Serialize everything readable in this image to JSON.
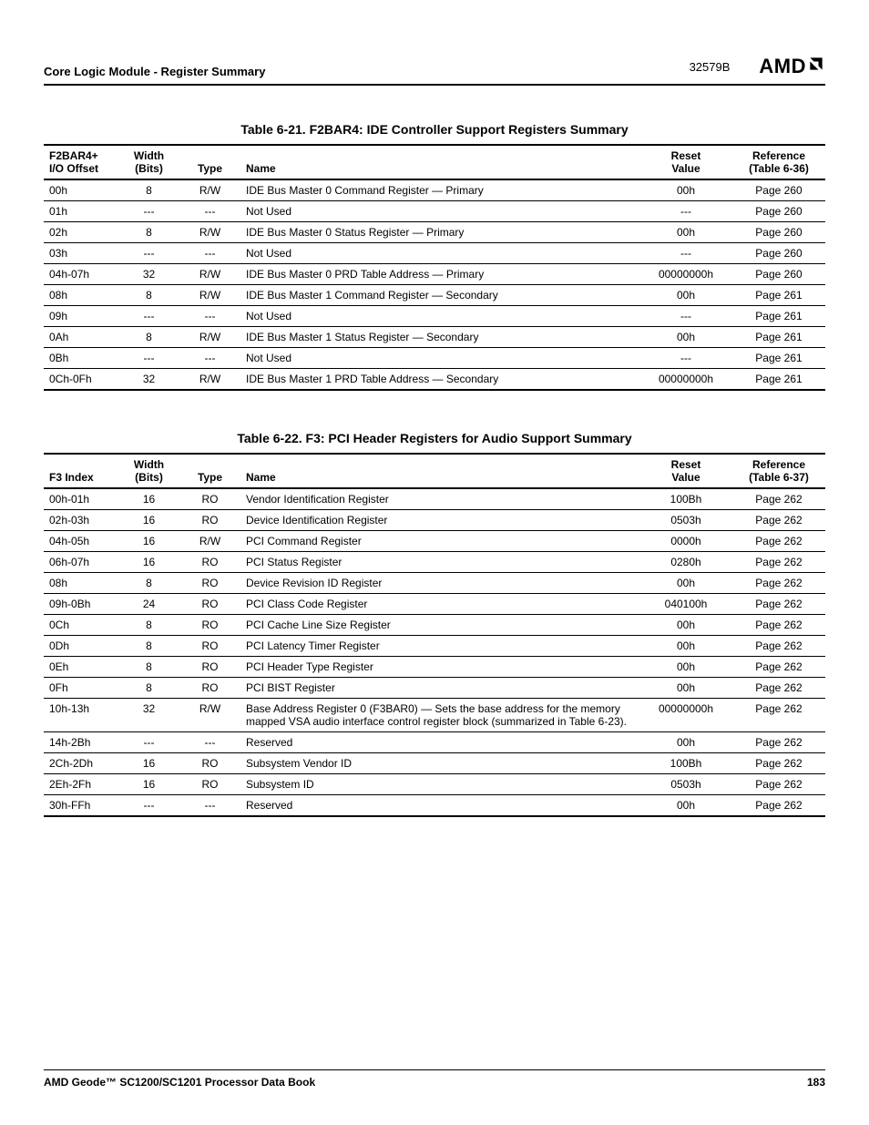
{
  "header": {
    "section": "Core Logic Module - Register Summary",
    "docnum": "32579B",
    "logo_text": "AMD"
  },
  "table1": {
    "caption": "Table 6-21.  F2BAR4: IDE Controller Support Registers Summary",
    "headers": {
      "offset": "F2BAR4+\nI/O Offset",
      "width": "Width\n(Bits)",
      "type": "Type",
      "name": "Name",
      "reset": "Reset\nValue",
      "ref": "Reference\n(Table 6-36)"
    },
    "rows": [
      {
        "offset": "00h",
        "width": "8",
        "type": "R/W",
        "name": "IDE Bus Master 0 Command Register — Primary",
        "reset": "00h",
        "ref": "Page 260"
      },
      {
        "offset": "01h",
        "width": "---",
        "type": "---",
        "name": "Not Used",
        "reset": "---",
        "ref": "Page 260"
      },
      {
        "offset": "02h",
        "width": "8",
        "type": "R/W",
        "name": "IDE Bus Master 0 Status Register — Primary",
        "reset": "00h",
        "ref": "Page 260"
      },
      {
        "offset": "03h",
        "width": "---",
        "type": "---",
        "name": "Not Used",
        "reset": "---",
        "ref": "Page 260"
      },
      {
        "offset": "04h-07h",
        "width": "32",
        "type": "R/W",
        "name": "IDE Bus Master 0 PRD Table Address — Primary",
        "reset": "00000000h",
        "ref": "Page 260"
      },
      {
        "offset": "08h",
        "width": "8",
        "type": "R/W",
        "name": "IDE Bus Master 1 Command Register — Secondary",
        "reset": "00h",
        "ref": "Page 261"
      },
      {
        "offset": "09h",
        "width": "---",
        "type": "---",
        "name": "Not Used",
        "reset": "---",
        "ref": "Page 261"
      },
      {
        "offset": "0Ah",
        "width": "8",
        "type": "R/W",
        "name": "IDE Bus Master 1 Status Register — Secondary",
        "reset": "00h",
        "ref": "Page 261"
      },
      {
        "offset": "0Bh",
        "width": "---",
        "type": "---",
        "name": "Not Used",
        "reset": "---",
        "ref": "Page 261"
      },
      {
        "offset": "0Ch-0Fh",
        "width": "32",
        "type": "R/W",
        "name": "IDE Bus Master 1 PRD Table Address — Secondary",
        "reset": "00000000h",
        "ref": "Page 261"
      }
    ]
  },
  "table2": {
    "caption": "Table 6-22.  F3: PCI Header Registers for Audio Support Summary",
    "headers": {
      "offset": "F3 Index",
      "width": "Width\n(Bits)",
      "type": "Type",
      "name": "Name",
      "reset": "Reset\nValue",
      "ref": "Reference\n(Table 6-37)"
    },
    "rows": [
      {
        "offset": "00h-01h",
        "width": "16",
        "type": "RO",
        "name": "Vendor Identification Register",
        "reset": "100Bh",
        "ref": "Page 262"
      },
      {
        "offset": "02h-03h",
        "width": "16",
        "type": "RO",
        "name": "Device Identification Register",
        "reset": "0503h",
        "ref": "Page 262"
      },
      {
        "offset": "04h-05h",
        "width": "16",
        "type": "R/W",
        "name": "PCI Command Register",
        "reset": "0000h",
        "ref": "Page 262"
      },
      {
        "offset": "06h-07h",
        "width": "16",
        "type": "RO",
        "name": "PCI Status Register",
        "reset": "0280h",
        "ref": "Page 262"
      },
      {
        "offset": "08h",
        "width": "8",
        "type": "RO",
        "name": "Device Revision ID Register",
        "reset": "00h",
        "ref": "Page 262"
      },
      {
        "offset": "09h-0Bh",
        "width": "24",
        "type": "RO",
        "name": "PCI Class Code Register",
        "reset": "040100h",
        "ref": "Page 262"
      },
      {
        "offset": "0Ch",
        "width": "8",
        "type": "RO",
        "name": "PCI Cache Line Size Register",
        "reset": "00h",
        "ref": "Page 262"
      },
      {
        "offset": "0Dh",
        "width": "8",
        "type": "RO",
        "name": "PCI Latency Timer Register",
        "reset": "00h",
        "ref": "Page 262"
      },
      {
        "offset": "0Eh",
        "width": "8",
        "type": "RO",
        "name": "PCI Header Type Register",
        "reset": "00h",
        "ref": "Page 262"
      },
      {
        "offset": "0Fh",
        "width": "8",
        "type": "RO",
        "name": "PCI BIST Register",
        "reset": "00h",
        "ref": "Page 262"
      },
      {
        "offset": "10h-13h",
        "width": "32",
        "type": "R/W",
        "name": "Base Address Register 0 (F3BAR0) — Sets the base address for the memory mapped VSA audio interface control register block (summarized in Table 6-23).",
        "reset": "00000000h",
        "ref": "Page 262"
      },
      {
        "offset": "14h-2Bh",
        "width": "---",
        "type": "---",
        "name": "Reserved",
        "reset": "00h",
        "ref": "Page 262"
      },
      {
        "offset": "2Ch-2Dh",
        "width": "16",
        "type": "RO",
        "name": "Subsystem Vendor ID",
        "reset": "100Bh",
        "ref": "Page 262"
      },
      {
        "offset": "2Eh-2Fh",
        "width": "16",
        "type": "RO",
        "name": "Subsystem ID",
        "reset": "0503h",
        "ref": "Page 262"
      },
      {
        "offset": "30h-FFh",
        "width": "---",
        "type": "---",
        "name": "Reserved",
        "reset": "00h",
        "ref": "Page 262"
      }
    ]
  },
  "footer": {
    "left": "AMD Geode™ SC1200/SC1201 Processor Data Book",
    "right": "183"
  }
}
